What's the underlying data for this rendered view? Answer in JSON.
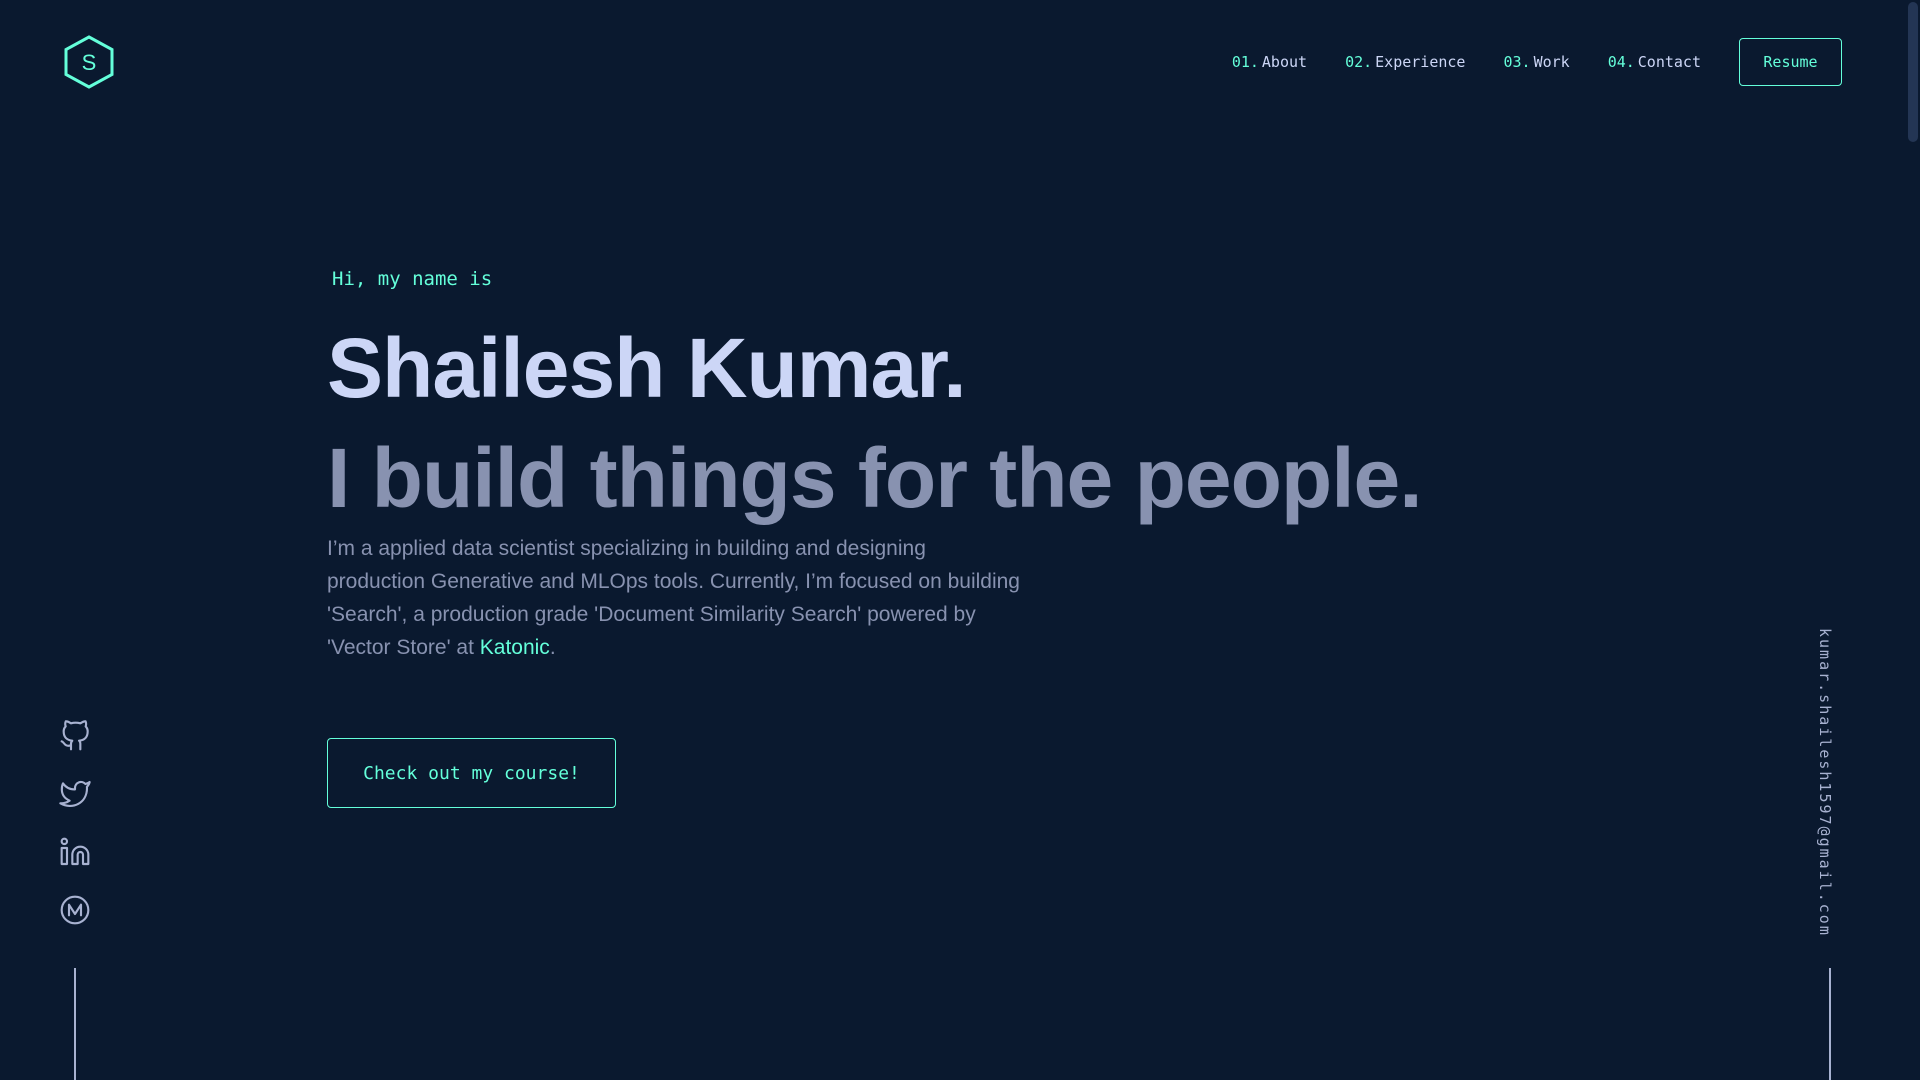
{
  "logo": {
    "letter": "S",
    "icon": "hexagon-logo-icon"
  },
  "nav": {
    "items": [
      {
        "num": "01.",
        "label": "About"
      },
      {
        "num": "02.",
        "label": "Experience"
      },
      {
        "num": "03.",
        "label": "Work"
      },
      {
        "num": "04.",
        "label": "Contact"
      }
    ],
    "resume_label": "Resume"
  },
  "hero": {
    "greeting": "Hi, my name is",
    "name": "Shailesh Kumar.",
    "tagline": "I build things for the people.",
    "bio_text": "I’m a applied data scientist specializing in building and designing production Generative and MLOps tools. Currently, I’m focused on building 'Search', a production grade 'Document Similarity Search' powered by 'Vector Store' at ",
    "bio_link": "Katonic",
    "bio_end": ".",
    "cta_label": "Check out my course!"
  },
  "social": [
    {
      "icon": "github-icon"
    },
    {
      "icon": "twitter-icon"
    },
    {
      "icon": "linkedin-icon"
    },
    {
      "icon": "medium-icon"
    }
  ],
  "email": "kumar.shailesh1597@gmail.com",
  "colors": {
    "background": "#0a192f",
    "accent": "#64ffda",
    "heading": "#ccd6f6",
    "text": "#8892b0"
  }
}
